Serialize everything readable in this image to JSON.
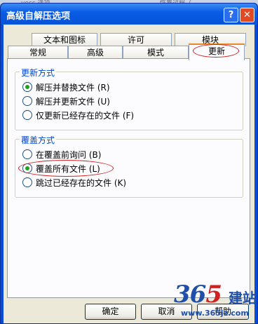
{
  "background_window": {
    "left_text": "vecc 选项",
    "right_text": "恢复过程（"
  },
  "dialog": {
    "title": "高级自解压选项",
    "help_glyph": "?",
    "close_glyph": "✕"
  },
  "tabs_back": [
    {
      "label": "文本和图标"
    },
    {
      "label": "许可"
    },
    {
      "label": "模块"
    }
  ],
  "tabs_front": [
    {
      "label": "常规"
    },
    {
      "label": "高级"
    },
    {
      "label": "模式"
    },
    {
      "label": "更新",
      "selected": true
    }
  ],
  "update_group": {
    "legend": "更新方式",
    "options": [
      {
        "label": "解压并替换文件 (R)",
        "checked": true
      },
      {
        "label": "解压并更新文件 (U)",
        "checked": false
      },
      {
        "label": "仅更新已经存在的文件 (F)",
        "checked": false
      }
    ]
  },
  "overwrite_group": {
    "legend": "覆盖方式",
    "options": [
      {
        "label": "在覆盖前询问 (B)",
        "checked": false
      },
      {
        "label": "覆盖所有文件 (L)",
        "checked": true
      },
      {
        "label": "跳过已经存在的文件 (K)",
        "checked": false
      }
    ]
  },
  "buttons": {
    "ok": "确定",
    "cancel": "取消",
    "help": "帮助"
  },
  "watermark": {
    "num_a": "36",
    "num_b": "5",
    "cn": "建站",
    "url": "www.365jz.com"
  },
  "colors": {
    "titlebar": "#0a5ce6",
    "face": "#ece9d8",
    "annotation": "#d02020",
    "radio_dot": "#21a121"
  }
}
